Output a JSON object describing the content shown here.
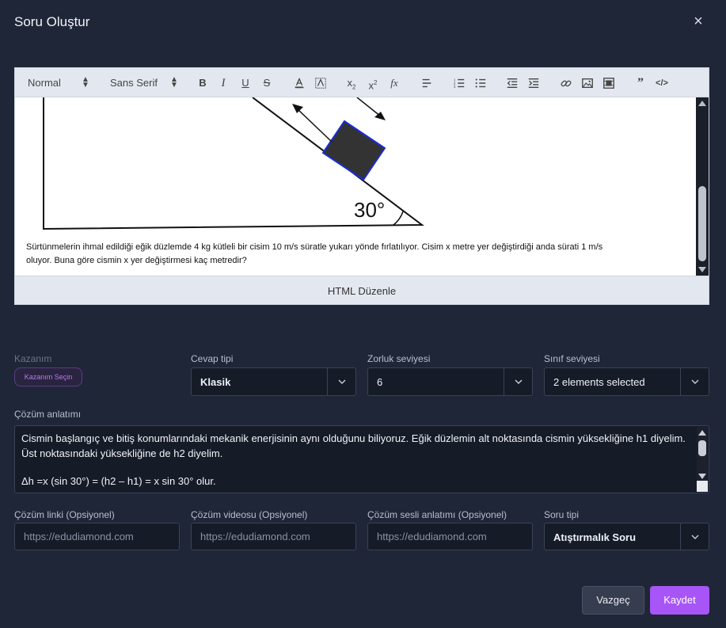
{
  "modal": {
    "title": "Soru Oluştur",
    "close_label": "×"
  },
  "editor": {
    "toolbar": {
      "header_select": "Normal",
      "font_select": "Sans Serif",
      "buttons": [
        "bold-icon",
        "italic-icon",
        "underline-icon",
        "strike-icon",
        "text-color-icon",
        "background-color-icon",
        "subscript-icon",
        "superscript-icon",
        "formula-icon",
        "align-icon",
        "ordered-list-icon",
        "bullet-list-icon",
        "outdent-icon",
        "indent-icon",
        "link-icon",
        "image-icon",
        "video-icon",
        "blockquote-icon",
        "code-block-icon"
      ]
    },
    "figure_angle_label": "30°",
    "question_text": "Sürtünmelerin ihmal edildiği eğik düzlemde 4 kg kütleli bir cisim 10 m/s süratle yukarı yönde fırlatılıyor. Cisim x metre yer değiştirdiği anda sürati 1 m/s oluyor. Buna göre cismin x yer değiştirmesi kaç metredir?",
    "html_edit_label": "HTML Düzenle"
  },
  "fields": {
    "kazanim": {
      "label": "Kazanım",
      "button": "Kazanım Seçin"
    },
    "cevap_tipi": {
      "label": "Cevap tipi",
      "value": "Klasik"
    },
    "zorluk": {
      "label": "Zorluk seviyesi",
      "value": "6"
    },
    "sinif": {
      "label": "Sınıf seviyesi",
      "value": "2 elements selected"
    },
    "cozum_anlatimi": {
      "label": "Çözüm anlatımı",
      "line1": "Cismin başlangıç ve bitiş konumlarındaki mekanik enerjisinin aynı olduğunu biliyoruz. Eğik düzlemin alt noktasında cismin yüksekliğine h1 diyelim. Üst noktasındaki yüksekliğine de h2 diyelim.",
      "line2": "Δh =x (sin 30°) = (h2 – h1) = x sin 30° olur."
    },
    "cozum_linki": {
      "label": "Çözüm linki (Opsiyonel)",
      "placeholder": "https://edudiamond.com"
    },
    "cozum_videosu": {
      "label": "Çözüm videosu (Opsiyonel)",
      "placeholder": "https://edudiamond.com"
    },
    "cozum_sesli": {
      "label": "Çözüm sesli anlatımı (Opsiyonel)",
      "placeholder": "https://edudiamond.com"
    },
    "soru_tipi": {
      "label": "Soru tipi",
      "value": "Atıştırmalık Soru"
    }
  },
  "actions": {
    "cancel": "Vazgeç",
    "save": "Kaydet"
  },
  "colors": {
    "background": "#1f2637",
    "accent": "#a855f7",
    "input_bg": "#161b28"
  }
}
